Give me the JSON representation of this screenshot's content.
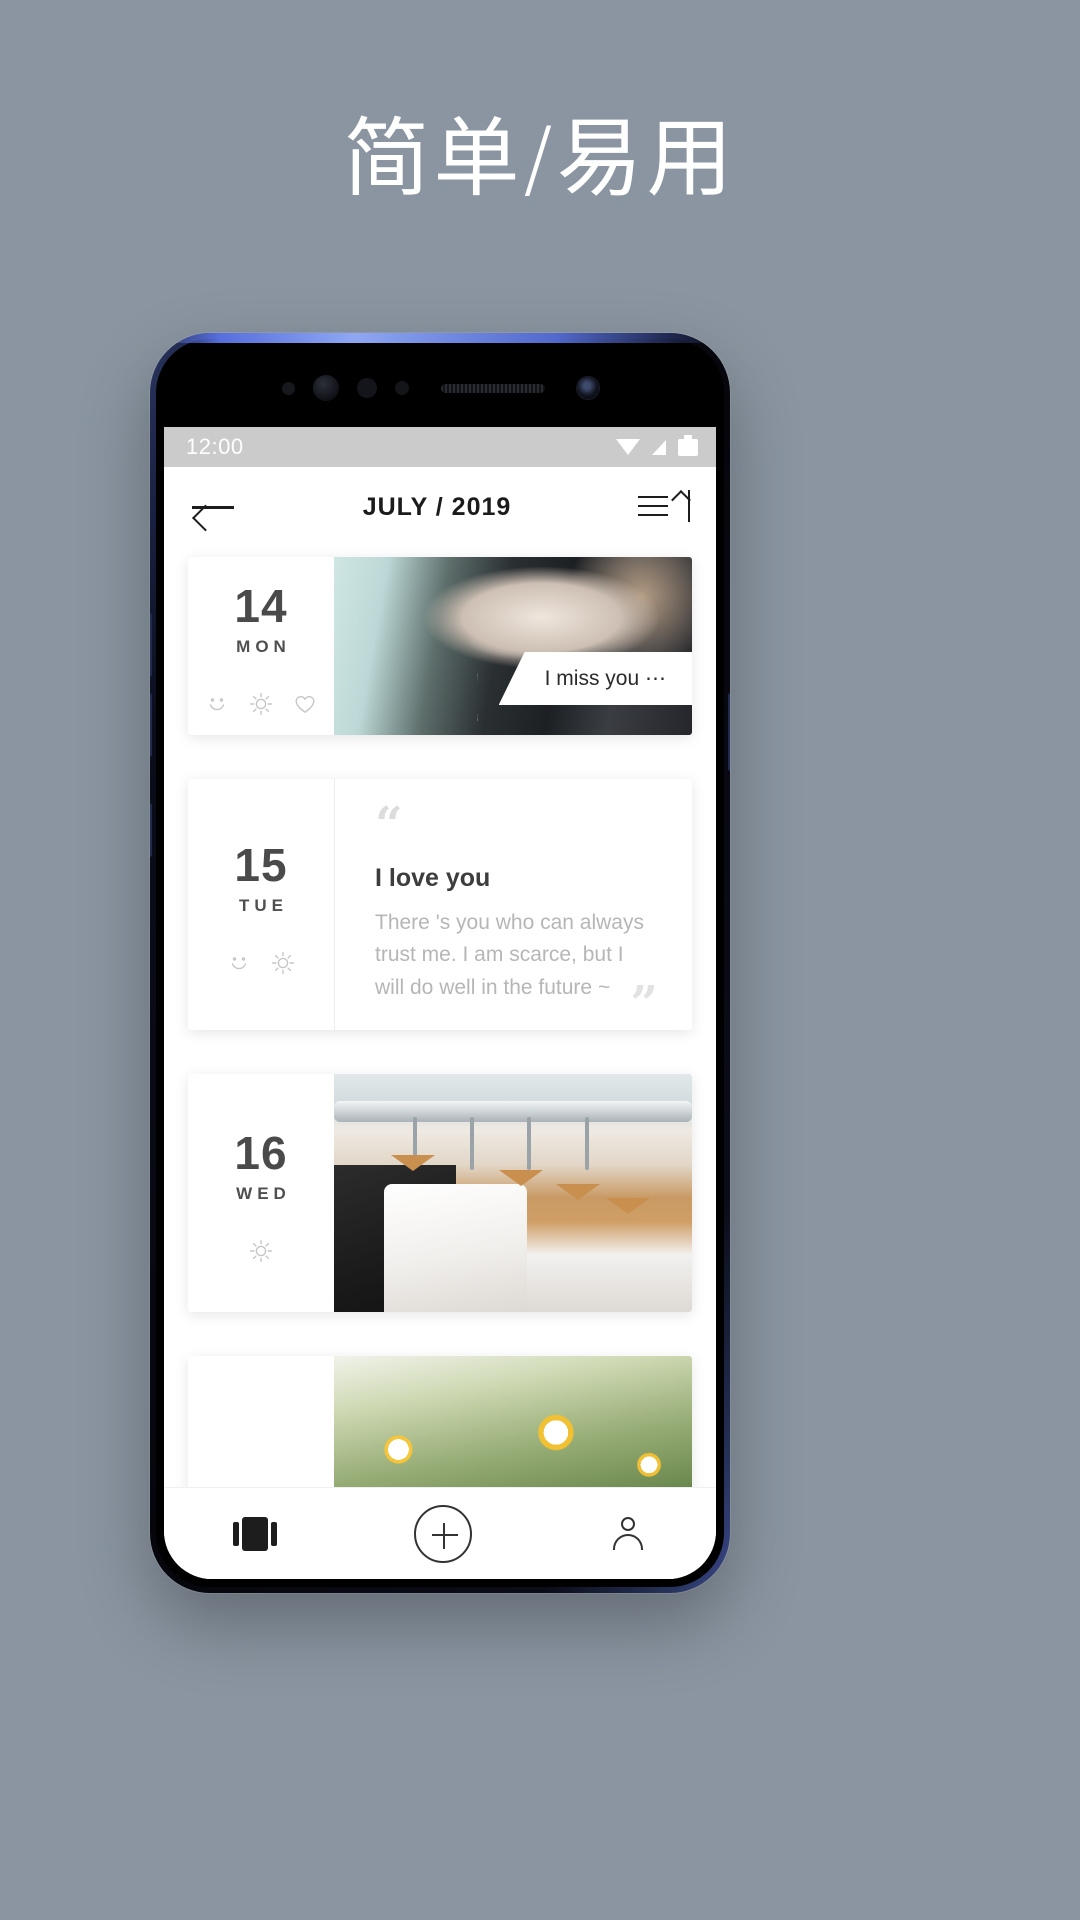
{
  "promo": {
    "heading": "简单/易用"
  },
  "status_bar": {
    "time": "12:00",
    "icons": [
      "wifi-icon",
      "signal-icon",
      "battery-icon"
    ]
  },
  "app_header": {
    "back_icon": "arrow-left-icon",
    "title": "JULY / 2019",
    "sort_icon": "sort-ascending-icon"
  },
  "feed": {
    "entries": [
      {
        "day": "14",
        "weekday": "MON",
        "moods": [
          "smiley-icon",
          "sun-icon",
          "heart-icon"
        ],
        "type": "photo",
        "photo": "cat-photo",
        "caption": "I miss you ⋯"
      },
      {
        "day": "15",
        "weekday": "TUE",
        "moods": [
          "smiley-icon",
          "sun-icon"
        ],
        "type": "quote",
        "quote_open": "“",
        "quote_close": "”",
        "title": "I love you",
        "text": "There 's you who can always trust me. I am scarce, but I will do well in the future ~"
      },
      {
        "day": "16",
        "weekday": "WED",
        "moods": [
          "sun-icon"
        ],
        "type": "photo",
        "photo": "clothes-hangers-photo",
        "caption": ""
      },
      {
        "day": "",
        "weekday": "",
        "moods": [],
        "type": "photo",
        "photo": "daisy-flowers-photo",
        "caption": ""
      }
    ]
  },
  "bottom_nav": {
    "items": [
      {
        "name": "cards-icon",
        "label": ""
      },
      {
        "name": "add-icon",
        "label": ""
      },
      {
        "name": "profile-icon",
        "label": ""
      }
    ]
  },
  "colors": {
    "background": "#8a95a1",
    "heading_text": "#ffffff",
    "status_bar": "#cbcbcb",
    "screen": "#ffffff",
    "primary_text": "#1b1b1b",
    "muted_text": "#b6b6b6",
    "phone_frame": "#0b0d1c",
    "phone_edge_blue": "#5a73e6"
  }
}
